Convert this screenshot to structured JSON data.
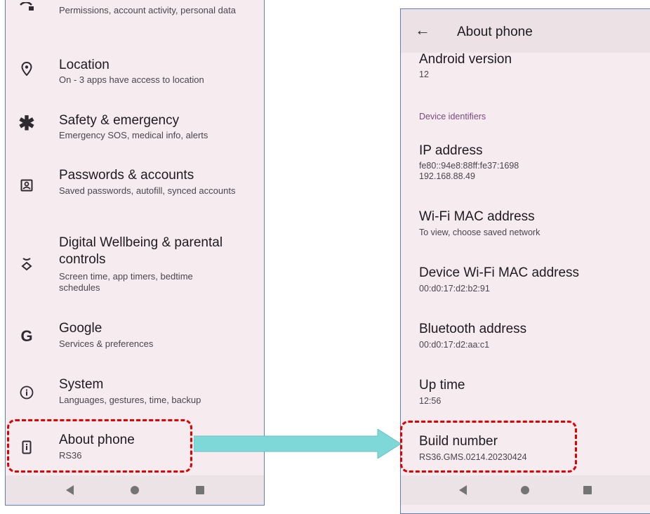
{
  "left_screen": {
    "items": [
      {
        "title": "",
        "subtitle": "Permissions, account activity, personal data",
        "icon": "privacy-icon"
      },
      {
        "title": "Location",
        "subtitle": "On - 3 apps have access to location",
        "icon": "location-icon"
      },
      {
        "title": "Safety & emergency",
        "subtitle": "Emergency SOS, medical info, alerts",
        "icon": "asterisk-icon"
      },
      {
        "title": "Passwords & accounts",
        "subtitle": "Saved passwords, autofill, synced accounts",
        "icon": "account-box-icon"
      },
      {
        "title": "Digital Wellbeing & parental controls",
        "subtitle": "Screen time, app timers, bedtime schedules",
        "icon": "wellbeing-icon"
      },
      {
        "title": "Google",
        "subtitle": "Services & preferences",
        "icon": "google-icon"
      },
      {
        "title": "System",
        "subtitle": "Languages, gestures, time, backup",
        "icon": "info-circle-icon"
      },
      {
        "title": "About phone",
        "subtitle": "RS36",
        "icon": "phone-info-icon"
      }
    ]
  },
  "right_screen": {
    "header": {
      "title": "About phone",
      "back_icon": "arrow-left-icon"
    },
    "android_version": {
      "title": "Android version",
      "value": "12"
    },
    "section_header": "Device identifiers",
    "ip_address": {
      "title": "IP address",
      "value": "fe80::94e8:88ff:fe37:1698\n192.168.88.49"
    },
    "wifi_mac": {
      "title": "Wi-Fi MAC address",
      "value": "To view, choose saved network"
    },
    "device_wifi_mac": {
      "title": "Device Wi-Fi MAC address",
      "value": "00:d0:17:d2:b2:91"
    },
    "bluetooth": {
      "title": "Bluetooth address",
      "value": "00:d0:17:d2:aa:c1"
    },
    "uptime": {
      "title": "Up time",
      "value": "12:56"
    },
    "build_number": {
      "title": "Build number",
      "value": "RS36.GMS.0214.20230424"
    }
  },
  "colors": {
    "highlight": "#e00000",
    "arrow": "#7fd8d8",
    "background": "#f6ebef"
  }
}
